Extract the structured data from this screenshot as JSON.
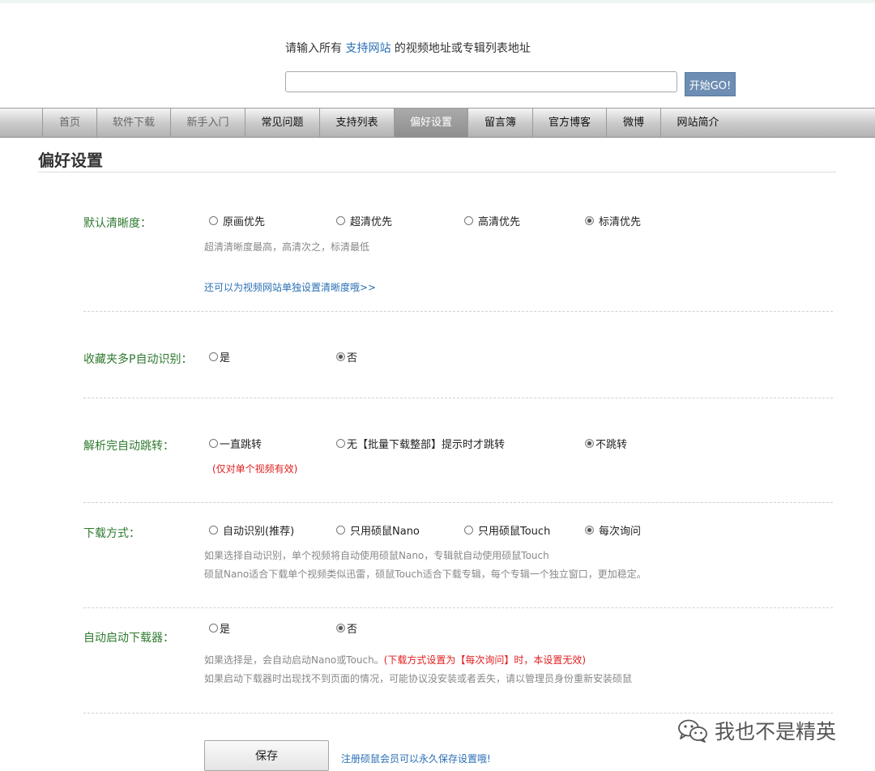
{
  "prompt": {
    "before": "请输入所有 ",
    "link": "支持网站",
    "after": " 的视频地址或专辑列表地址"
  },
  "search": {
    "value": "",
    "go_label": "开始GO!"
  },
  "nav": {
    "items": [
      {
        "label": "首页"
      },
      {
        "label": "软件下载"
      },
      {
        "label": "新手入门"
      },
      {
        "label": "常见问题"
      },
      {
        "label": "支持列表"
      },
      {
        "label": "偏好设置"
      },
      {
        "label": "留言簿"
      },
      {
        "label": "官方博客"
      },
      {
        "label": "微博"
      },
      {
        "label": "网站简介"
      }
    ]
  },
  "page_title": "偏好设置",
  "sections": {
    "quality": {
      "label": "默认清晰度：",
      "options": [
        "原画优先",
        "超清优先",
        "高清优先",
        "标清优先"
      ],
      "selected": "标清优先",
      "hint": "超清清晰度最高，高清次之，标清最低",
      "link": "还可以为视频网站单独设置清晰度哦>>"
    },
    "multipart": {
      "label": "收藏夹多P自动识别：",
      "options": [
        "是",
        "否"
      ],
      "selected": "否"
    },
    "redirect": {
      "label": "解析完自动跳转：",
      "options": [
        "一直跳转",
        "无【批量下载整部】提示时才跳转",
        "不跳转"
      ],
      "selected": "不跳转",
      "note": "(仅对单个视频有效)"
    },
    "download_mode": {
      "label": "下载方式：",
      "options": [
        "自动识别(推荐)",
        "只用硕鼠Nano",
        "只用硕鼠Touch",
        "每次询问"
      ],
      "selected": "每次询问",
      "hint1": "如果选择自动识别，单个视频将自动使用硕鼠Nano，专辑就自动使用硕鼠Touch",
      "hint2": "硕鼠Nano适合下载单个视频类似迅雷，硕鼠Touch适合下载专辑，每个专辑一个独立窗口，更加稳定。"
    },
    "autostart": {
      "label": "自动启动下载器：",
      "options": [
        "是",
        "否"
      ],
      "selected": "否",
      "hint1": "如果选择是，会自动启动Nano或Touch。",
      "warn": "(下载方式设置为【每次询问】时，本设置无效)",
      "hint2": "如果启动下载器时出现找不到页面的情况，可能协议没安装或者丢失，请以管理员身份重新安装硕鼠"
    }
  },
  "save": {
    "label": "保存",
    "note": "注册硕鼠会员可以永久保存设置哦!"
  },
  "watermark": {
    "text": "我也不是精英",
    "icon": "wechat-icon"
  },
  "colors": {
    "label_green": "#2f7a2f",
    "link_blue": "#2a6fb5",
    "warn_red": "#e02020",
    "go_button": "#6d8db3"
  }
}
